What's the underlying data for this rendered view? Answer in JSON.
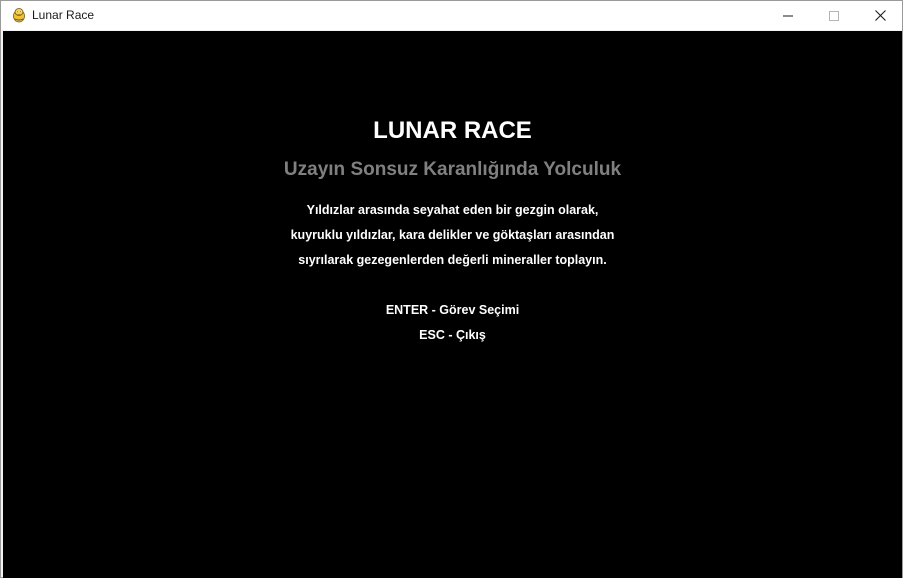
{
  "window": {
    "title": "Lunar Race",
    "app_icon": "pygame-snake-icon",
    "controls": {
      "minimize_icon": "minimize-icon",
      "maximize_icon": "maximize-icon",
      "close_icon": "close-icon"
    }
  },
  "game": {
    "title": "LUNAR RACE",
    "subtitle": "Uzayın Sonsuz Karanlığında Yolculuk",
    "description_lines": [
      "Yıldızlar arasında seyahat eden bir gezgin olarak,",
      "kuyruklu yıldızlar, kara delikler ve göktaşları arasından",
      "sıyrılarak gezegenlerden değerli mineraller toplayın."
    ],
    "menu": {
      "enter_option": "ENTER - Görev Seçimi",
      "esc_option": "ESC - Çıkış"
    }
  },
  "colors": {
    "background": "#000000",
    "title": "#ffffff",
    "subtitle": "#808080",
    "text": "#ffffff",
    "titlebar": "#ffffff"
  }
}
